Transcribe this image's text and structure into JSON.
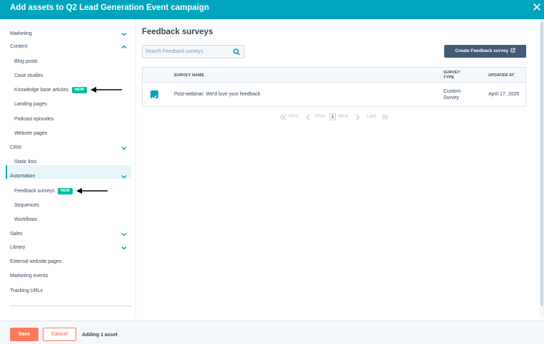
{
  "header": {
    "title": "Add assets to Q2 Lead Generation Event campaign",
    "close": "✕"
  },
  "sidebar": {
    "marketing": "Marketing",
    "content": "Content",
    "content_items": [
      "Blog posts",
      "Case studies",
      "Knowledge base articles",
      "Landing pages",
      "Podcast episodes",
      "Website pages"
    ],
    "crm": "CRM",
    "crm_items": [
      "Static lists"
    ],
    "automation": "Automation",
    "automation_items": [
      "Feedback surveys",
      "Sequences",
      "Workflows"
    ],
    "sales": "Sales",
    "library": "Library",
    "external": "External website pages",
    "marketing_events": "Marketing events",
    "tracking": "Tracking URLs",
    "new_badge": "NEW"
  },
  "main": {
    "title": "Feedback surveys",
    "search_placeholder": "Search Feedback surveys",
    "create_button": "Create Feedback survey",
    "columns": {
      "name": "SURVEY NAME",
      "type_line1": "SURVEY",
      "type_line2": "TYPE",
      "updated": "UPDATED AT"
    },
    "rows": [
      {
        "name": "Post-webinar: We'd love your feedback",
        "type_line1": "Custom",
        "type_line2": "Survey",
        "updated": "April 17, 2025",
        "checked": true
      }
    ],
    "pager": {
      "first": "First",
      "prev": "Prev",
      "current": "1",
      "next": "Next",
      "last": "Last"
    }
  },
  "footer": {
    "save": "Save",
    "cancel": "Cancel",
    "status": "Adding 1 asset"
  },
  "colors": {
    "header": "#00a4bd",
    "primary_button": "#ff7a59",
    "dark_button": "#425b76",
    "badge": "#00bda5",
    "active_bg": "#e5f5f8"
  }
}
